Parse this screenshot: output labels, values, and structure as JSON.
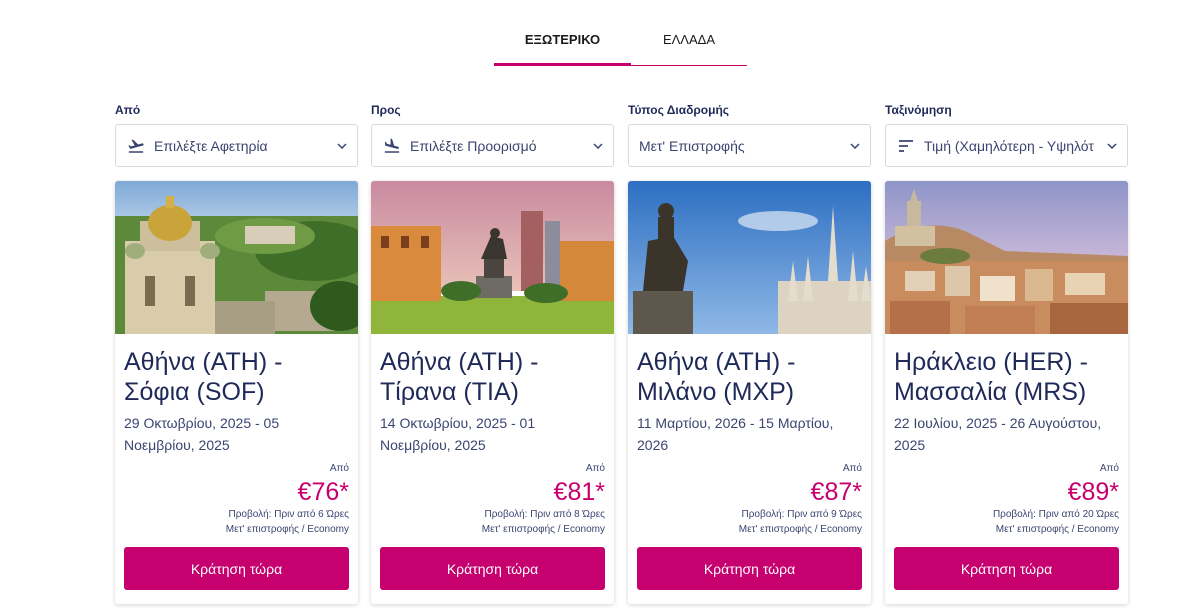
{
  "tabs": [
    {
      "label": "ΕΞΩΤΕΡΙΚΟ",
      "active": true
    },
    {
      "label": "ΕΛΛΑΔΑ",
      "active": false
    }
  ],
  "filters": [
    {
      "label": "Από",
      "value": "Επιλέξτε Αφετηρία",
      "icon": "plane-takeoff-icon"
    },
    {
      "label": "Προς",
      "value": "Επιλέξτε Προορισμό",
      "icon": "plane-landing-icon"
    },
    {
      "label": "Τύπος Διαδρομής",
      "value": "Μετ' Επιστροφής",
      "icon": ""
    },
    {
      "label": "Ταξινόμηση",
      "value": "Τιμή (Χαμηλότερη - Υψηλότ",
      "icon": "sort-icon"
    }
  ],
  "cards": [
    {
      "title": "Αθήνα (ATH) - Σόφια (SOF)",
      "dates": "29 Οκτωβρίου, 2025 - 05 Νοεμβρίου, 2025",
      "from_label": "Από",
      "price": "€76*",
      "view_note": "Προβολή: Πριν από 6 Ώρες",
      "fare_note": "Μετ' επιστροφής / Economy",
      "button": "Κράτηση τώρα",
      "image": "sofia-cathedral-photo"
    },
    {
      "title": "Αθήνα (ATH) - Τίρανα (TIA)",
      "dates": "14 Οκτωβρίου, 2025 - 01 Νοεμβρίου, 2025",
      "from_label": "Από",
      "price": "€81*",
      "view_note": "Προβολή: Πριν από 8 Ώρες",
      "fare_note": "Μετ' επιστροφής / Economy",
      "button": "Κράτηση τώρα",
      "image": "tirana-statue-photo"
    },
    {
      "title": "Αθήνα (ATH) - Μιλάνο (MXP)",
      "dates": "11 Μαρτίου, 2026 - 15 Μαρτίου, 2026",
      "from_label": "Από",
      "price": "€87*",
      "view_note": "Προβολή: Πριν από 9 Ώρες",
      "fare_note": "Μετ' επιστροφής / Economy",
      "button": "Κράτηση τώρα",
      "image": "milan-duomo-photo"
    },
    {
      "title": "Ηράκλειο (HER) - Μασσαλία (MRS)",
      "dates": "22 Ιουλίου, 2025 - 26 Αυγούστου, 2025",
      "from_label": "Από",
      "price": "€89*",
      "view_note": "Προβολή: Πριν από 20 Ώρες",
      "fare_note": "Μετ' επιστροφής / Economy",
      "button": "Κράτηση τώρα",
      "image": "marseille-city-photo"
    }
  ],
  "colors": {
    "accent": "#c6006e",
    "text": "#1f2a5a"
  }
}
